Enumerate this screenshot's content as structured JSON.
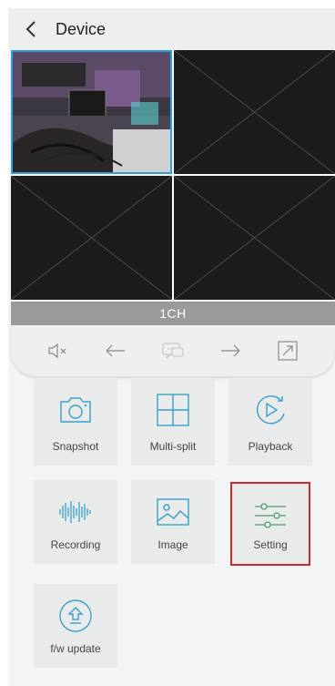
{
  "header": {
    "title": "Device",
    "back_icon": "chevron-left-icon"
  },
  "video": {
    "channels": 4,
    "active_channel": 1,
    "channel_label": "1CH"
  },
  "controls": [
    {
      "name": "mute",
      "icon": "speaker-muted-icon"
    },
    {
      "name": "undo",
      "icon": "undo-arrow-icon"
    },
    {
      "name": "chat",
      "icon": "chat-bubble-icon",
      "disabled": true
    },
    {
      "name": "redo",
      "icon": "redo-arrow-icon"
    },
    {
      "name": "fullscreen",
      "icon": "fullscreen-icon"
    }
  ],
  "tiles": {
    "snapshot": "Snapshot",
    "multi_split": "Multi-split",
    "playback": "Playback",
    "recording": "Recording",
    "image": "Image",
    "setting": "Setting",
    "fw_update": "f/w update"
  },
  "colors": {
    "accent": "#3a9fc9",
    "highlight": "#4e9e6e",
    "selected_border": "#cc2a2a",
    "active_feed_border": "#2f9fd7"
  }
}
